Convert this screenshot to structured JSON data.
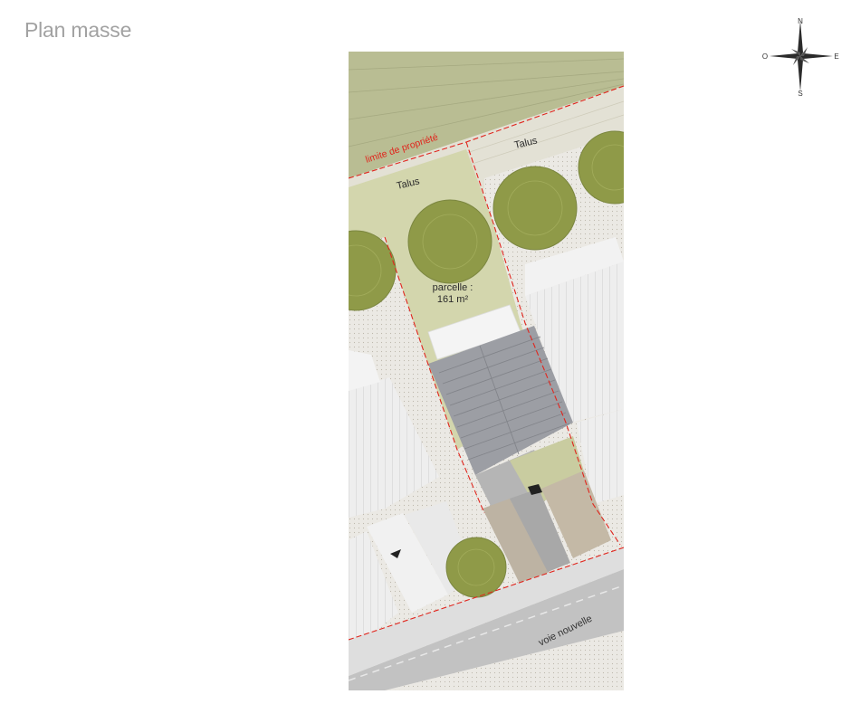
{
  "title": "Plan masse",
  "compass": {
    "n": "N",
    "s": "S",
    "e": "E",
    "o": "O"
  },
  "labels": {
    "property_limit": "limite de propriété",
    "talus_left": "Talus",
    "talus_right": "Talus",
    "parcel_line1": "parcelle :",
    "parcel_line2": "161 m²",
    "road": "voie nouvelle"
  },
  "colors": {
    "grass": "#b9bd93",
    "parcel": "#d3d6ad",
    "tree": "#8f9a48",
    "roof": "#9c9ea4",
    "road": "#c2c2c2",
    "paving": "#bdb3a3",
    "limit": "#e0261e"
  }
}
